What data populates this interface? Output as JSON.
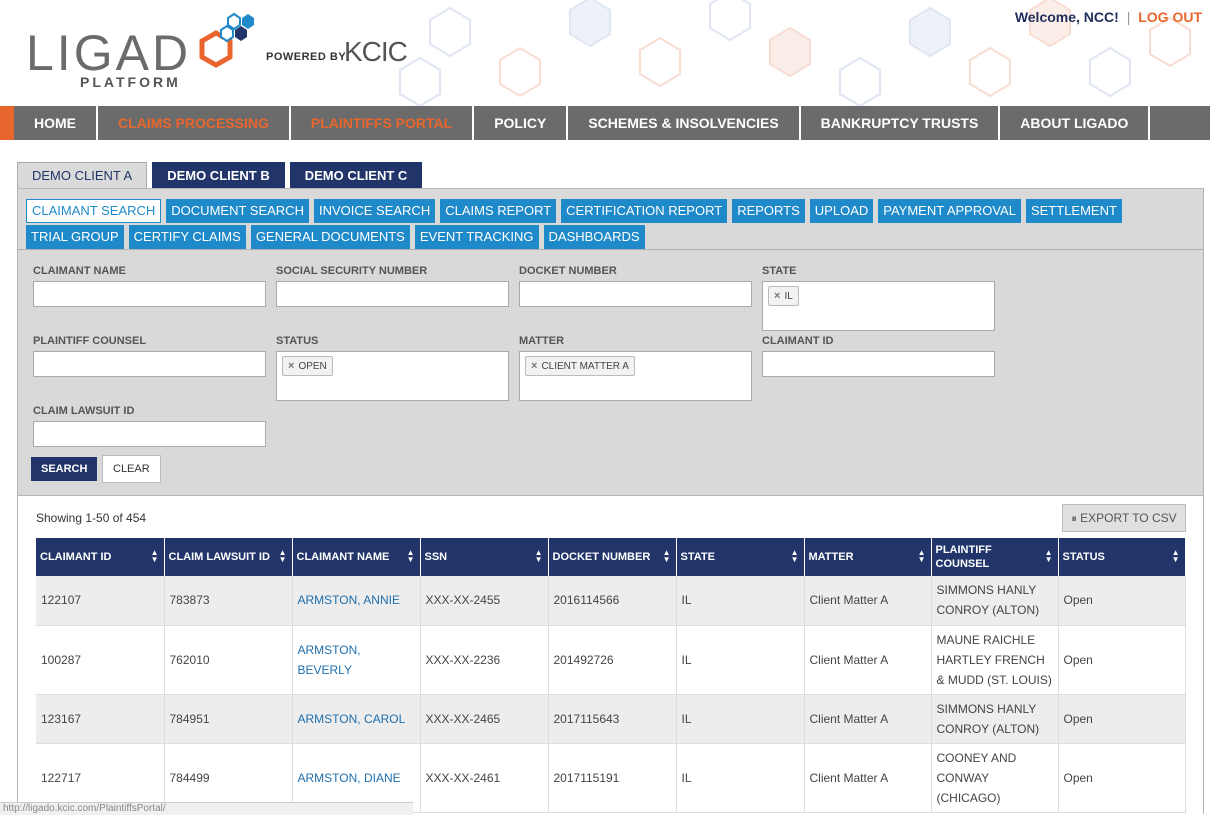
{
  "header": {
    "logo_text": "LIGAD",
    "platform": "PLATFORM",
    "powered_by": "POWERED BY",
    "kcic": "KCIC",
    "welcome": "Welcome, NCC!",
    "separator": "|",
    "logout": "LOG OUT"
  },
  "nav": {
    "items": [
      {
        "label": "HOME"
      },
      {
        "label": "CLAIMS PROCESSING"
      },
      {
        "label": "PLAINTIFFS PORTAL"
      },
      {
        "label": "POLICY"
      },
      {
        "label": "SCHEMES & INSOLVENCIES"
      },
      {
        "label": "BANKRUPTCY TRUSTS"
      },
      {
        "label": "ABOUT LIGADO"
      }
    ]
  },
  "client_tabs": [
    "DEMO CLIENT A",
    "DEMO CLIENT B",
    "DEMO CLIENT C"
  ],
  "sub_tabs_row1": [
    "CLAIMANT SEARCH",
    "DOCUMENT SEARCH",
    "INVOICE SEARCH",
    "CLAIMS REPORT",
    "CERTIFICATION REPORT",
    "REPORTS",
    "UPLOAD",
    "PAYMENT APPROVAL",
    "SETTLEMENT"
  ],
  "sub_tabs_row2": [
    "TRIAL GROUP",
    "CERTIFY CLAIMS",
    "GENERAL DOCUMENTS",
    "EVENT TRACKING",
    "DASHBOARDS"
  ],
  "filters": {
    "claimant_name": {
      "label": "CLAIMANT NAME",
      "value": ""
    },
    "ssn": {
      "label": "SOCIAL SECURITY NUMBER",
      "value": ""
    },
    "docket_number": {
      "label": "DOCKET NUMBER",
      "value": ""
    },
    "state": {
      "label": "STATE",
      "chip": "IL"
    },
    "plaintiff_counsel": {
      "label": "PLAINTIFF COUNSEL",
      "value": ""
    },
    "status": {
      "label": "STATUS",
      "chip": "OPEN"
    },
    "matter": {
      "label": "MATTER",
      "chip": "CLIENT MATTER A"
    },
    "claimant_id": {
      "label": "CLAIMANT ID",
      "value": ""
    },
    "claim_lawsuit_id": {
      "label": "CLAIM LAWSUIT ID",
      "value": ""
    },
    "search_label": "SEARCH",
    "clear_label": "CLEAR",
    "chip_remove": "×"
  },
  "results": {
    "showing": "Showing 1-50 of 454",
    "export_label": "EXPORT TO CSV",
    "columns": [
      "CLAIMANT ID",
      "CLAIM LAWSUIT ID",
      "CLAIMANT NAME",
      "SSN",
      "DOCKET NUMBER",
      "STATE",
      "MATTER",
      "PLAINTIFF COUNSEL",
      "STATUS"
    ],
    "rows": [
      [
        "122107",
        "783873",
        "ARMSTON, ANNIE",
        "XXX-XX-2455",
        "2016114566",
        "IL",
        "Client Matter A",
        "SIMMONS HANLY CONROY (ALTON)",
        "Open"
      ],
      [
        "100287",
        "762010",
        "ARMSTON, BEVERLY",
        "XXX-XX-2236",
        "201492726",
        "IL",
        "Client Matter A",
        "MAUNE RAICHLE HARTLEY FRENCH & MUDD (ST. LOUIS)",
        "Open"
      ],
      [
        "123167",
        "784951",
        "ARMSTON, CAROL",
        "XXX-XX-2465",
        "2017115643",
        "IL",
        "Client Matter A",
        "SIMMONS HANLY CONROY (ALTON)",
        "Open"
      ],
      [
        "122717",
        "784499",
        "ARMSTON, DIANE",
        "XXX-XX-2461",
        "2017115191",
        "IL",
        "Client Matter A",
        "COONEY AND CONWAY (CHICAGO)",
        "Open"
      ]
    ]
  },
  "status_bar": "http://ligado.kcic.com/PlaintiffsPortal/",
  "colors": {
    "navy": "#22356a",
    "orange": "#e8662d",
    "blue": "#1f8ac9",
    "nav_gray": "#6b6b6b"
  }
}
